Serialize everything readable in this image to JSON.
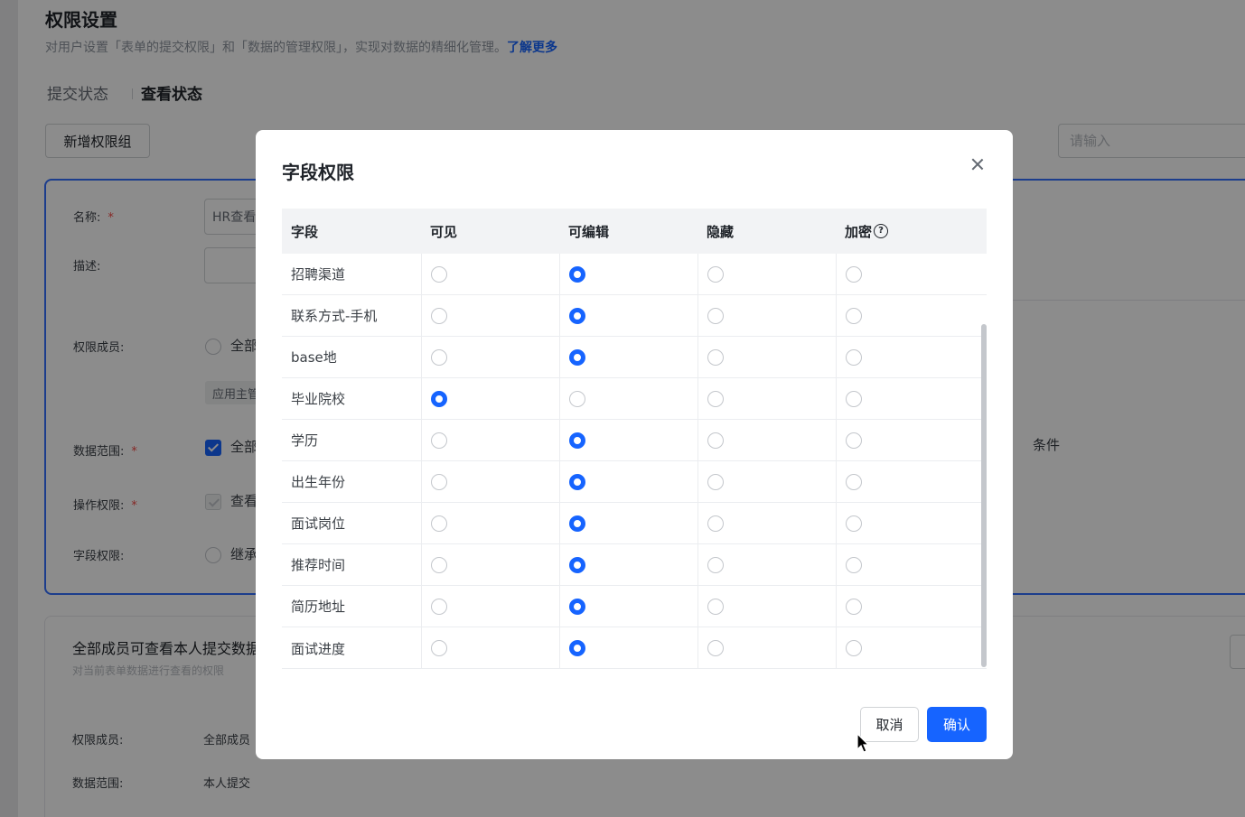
{
  "page": {
    "title": "权限设置",
    "description": "对用户设置「表单的提交权限」和「数据的管理权限」，实现对数据的精细化管理。",
    "learn_more": "了解更多",
    "tabs": [
      {
        "label": "提交状态",
        "active": false
      },
      {
        "label": "查看状态",
        "active": true
      }
    ],
    "add_group_button": "新增权限组",
    "search_placeholder": "请输入"
  },
  "group_card": {
    "name_label": "名称:",
    "name_value": "HR查看",
    "desc_label": "描述:",
    "members_label": "权限成员:",
    "members_option": "全部",
    "members_tag": "应用主管",
    "data_scope_label": "数据范围:",
    "data_scope_option": "全部",
    "right_fragment": "条件",
    "operation_label": "操作权限:",
    "operation_option": "查看",
    "field_label": "字段权限:",
    "field_option": "继承"
  },
  "second_card": {
    "title": "全部成员可查看本人提交数据",
    "subtitle": "对当前表单数据进行查看的权限",
    "members_label": "权限成员:",
    "members_value": "全部成员",
    "data_scope_label": "数据范围:",
    "data_scope_value": "本人提交"
  },
  "modal": {
    "title": "字段权限",
    "columns": [
      "字段",
      "可见",
      "可编辑",
      "隐藏",
      "加密"
    ],
    "help_icon_text": "?",
    "rows": [
      {
        "field": "招聘渠道",
        "selected": "可编辑"
      },
      {
        "field": "联系方式-手机",
        "selected": "可编辑"
      },
      {
        "field": "base地",
        "selected": "可编辑"
      },
      {
        "field": "毕业院校",
        "selected": "可见"
      },
      {
        "field": "学历",
        "selected": "可编辑"
      },
      {
        "field": "出生年份",
        "selected": "可编辑"
      },
      {
        "field": "面试岗位",
        "selected": "可编辑"
      },
      {
        "field": "推荐时间",
        "selected": "可编辑"
      },
      {
        "field": "简历地址",
        "selected": "可编辑"
      },
      {
        "field": "面试进度",
        "selected": "可编辑"
      }
    ],
    "cancel_label": "取消",
    "confirm_label": "确认"
  },
  "colors": {
    "primary": "#1664ff",
    "required": "#f54a45",
    "mask": "rgba(0,0,0,0.45)"
  },
  "icons": [
    "close-icon",
    "help-icon",
    "cursor-icon"
  ]
}
